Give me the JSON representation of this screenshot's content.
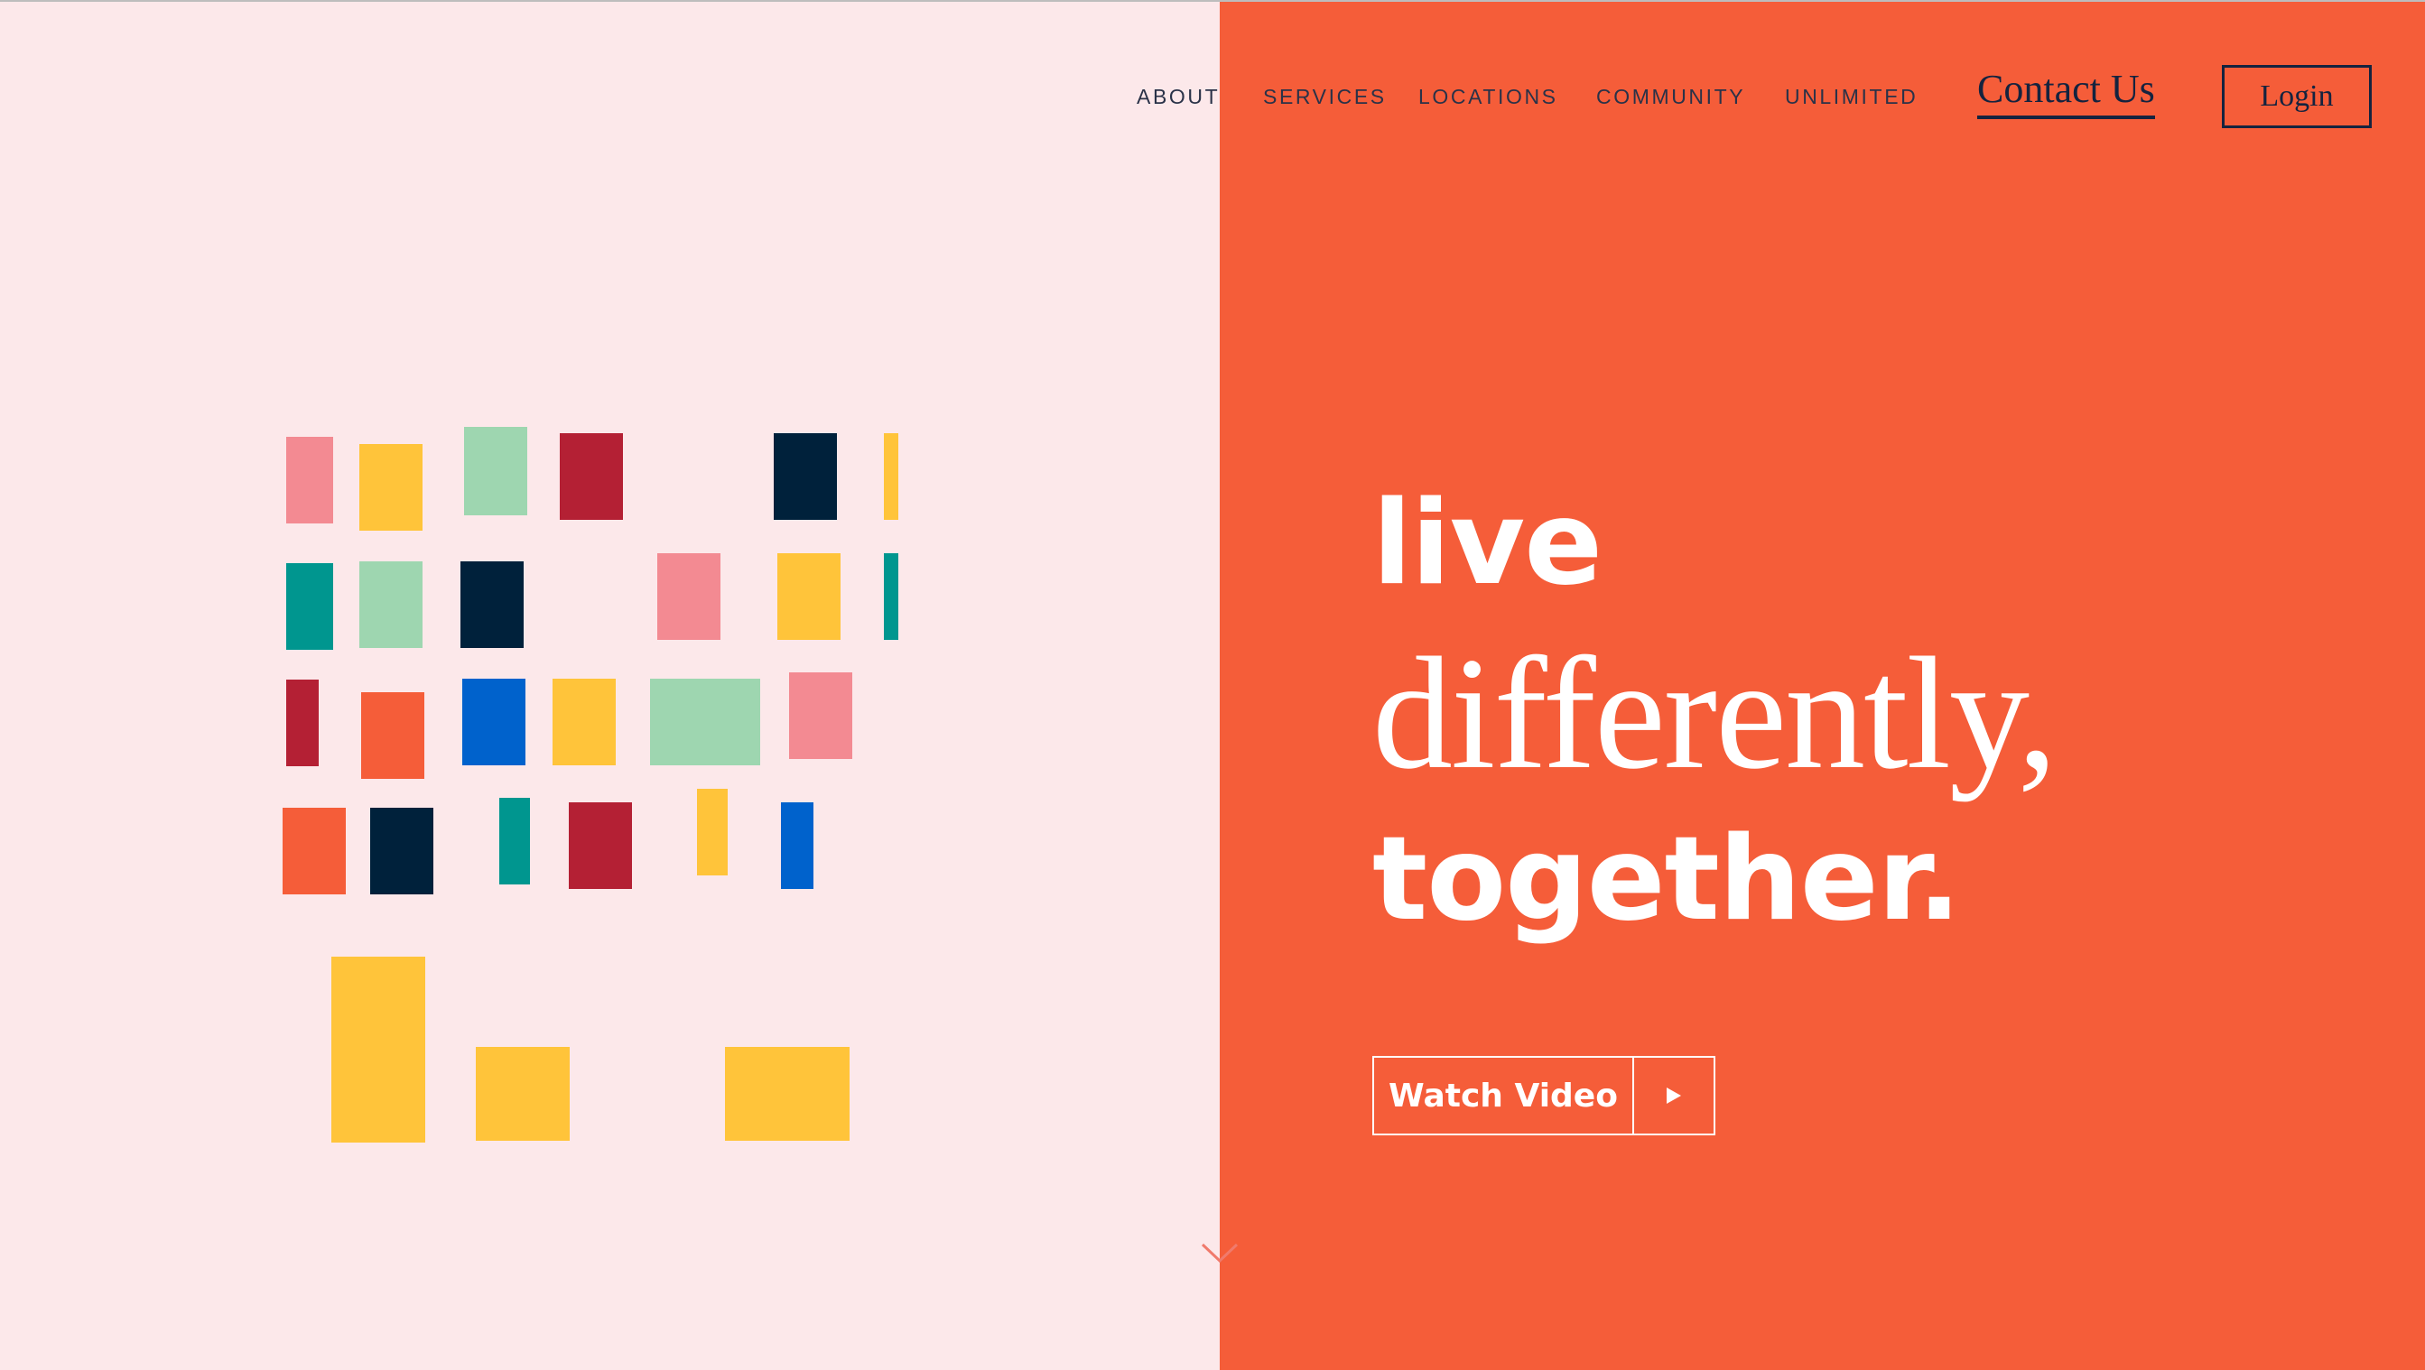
{
  "nav": {
    "items": [
      "ABOUT",
      "SERVICES",
      "LOCATIONS",
      "COMMUNITY",
      "UNLIMITED"
    ],
    "contact_label": "Contact Us",
    "login_label": "Login"
  },
  "hero": {
    "line1": "live",
    "line2": "differently,",
    "line3": "together.",
    "watch_label": "Watch Video",
    "play_icon": "play-icon"
  },
  "scroll_icon": "chevron-down-icon",
  "colors": {
    "left_bg": "#fce8ea",
    "right_bg": "#f55d39",
    "navy": "#14233f",
    "pink": "#f38a92",
    "yellow": "#ffc43a",
    "mint": "#9ed6b0",
    "crimson": "#b42034",
    "dark_navy": "#00213b",
    "teal": "#00968f",
    "blue": "#0062cc",
    "orange": "#f55d39"
  },
  "blocks": [
    "pink",
    "yellow",
    "mint",
    "crimson",
    "dark_navy",
    "yellow",
    "teal",
    "mint",
    "dark_navy",
    "pink",
    "yellow",
    "teal",
    "crimson",
    "orange",
    "blue",
    "yellow",
    "mint",
    "pink",
    "orange",
    "dark_navy",
    "teal",
    "crimson",
    "yellow",
    "blue",
    "yellow",
    "yellow",
    "yellow"
  ]
}
